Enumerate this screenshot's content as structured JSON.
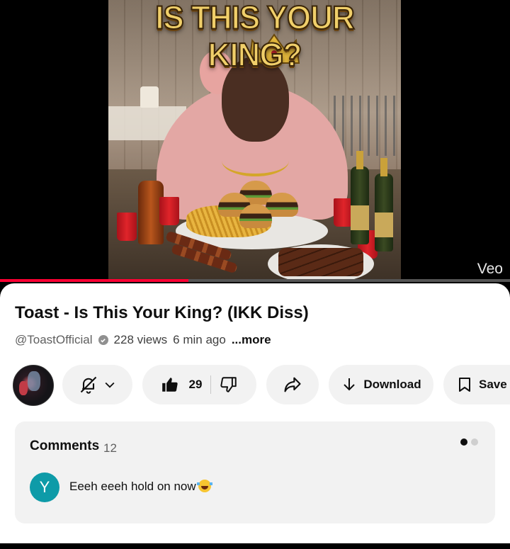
{
  "video": {
    "thumbnail_title": "IS THIS YOUR KING?",
    "watermark": "Veo",
    "progress_percent": 37
  },
  "details": {
    "title": "Toast - Is This Your King? (IKK Diss)",
    "channel_handle": "@ToastOfficial",
    "views": "228 views",
    "time_ago": "6 min ago",
    "more_label": "...more"
  },
  "actions": {
    "like_count": "29",
    "download_label": "Download",
    "save_label": "Save"
  },
  "comments": {
    "header": "Comments",
    "count": "12",
    "first_comment": {
      "author_initial": "Y",
      "text": "Eeeh eeeh hold on now"
    }
  },
  "colors": {
    "progress_red": "#ff0033",
    "comment_avatar": "#0e9ba8",
    "pill_bg": "#f2f2f2"
  }
}
